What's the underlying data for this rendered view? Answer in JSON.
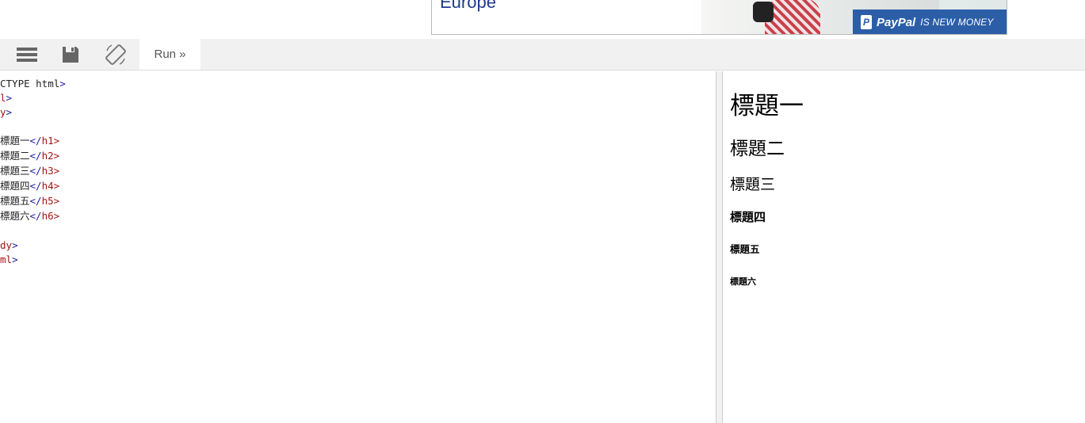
{
  "ad": {
    "headline": "Europe",
    "brand": "PayPal",
    "tagline": "IS NEW MONEY"
  },
  "toolbar": {
    "run_label": "Run »"
  },
  "editor": {
    "lines": [
      {
        "a": "",
        "b": "CTYPE html",
        "c": ">"
      },
      {
        "a": "",
        "b": "l",
        "c": ">"
      },
      {
        "a": "",
        "b": "y",
        "c": ">"
      },
      {
        "a": "",
        "b": "",
        "c": ""
      },
      {
        "a": "標題一",
        "b": "</",
        "c": "h1>"
      },
      {
        "a": "標題二",
        "b": "</",
        "c": "h2>"
      },
      {
        "a": "標題三",
        "b": "</",
        "c": "h3>"
      },
      {
        "a": "標題四",
        "b": "</",
        "c": "h4>"
      },
      {
        "a": "標題五",
        "b": "</",
        "c": "h5>"
      },
      {
        "a": "標題六",
        "b": "</",
        "c": "h6>"
      },
      {
        "a": "",
        "b": "",
        "c": ""
      },
      {
        "a": "",
        "b": "dy",
        "c": ">"
      },
      {
        "a": "",
        "b": "ml",
        "c": ">"
      }
    ]
  },
  "result": {
    "h1": "標題一",
    "h2": "標題二",
    "h3": "標題三",
    "h4": "標題四",
    "h5": "標題五",
    "h6": "標題六"
  }
}
